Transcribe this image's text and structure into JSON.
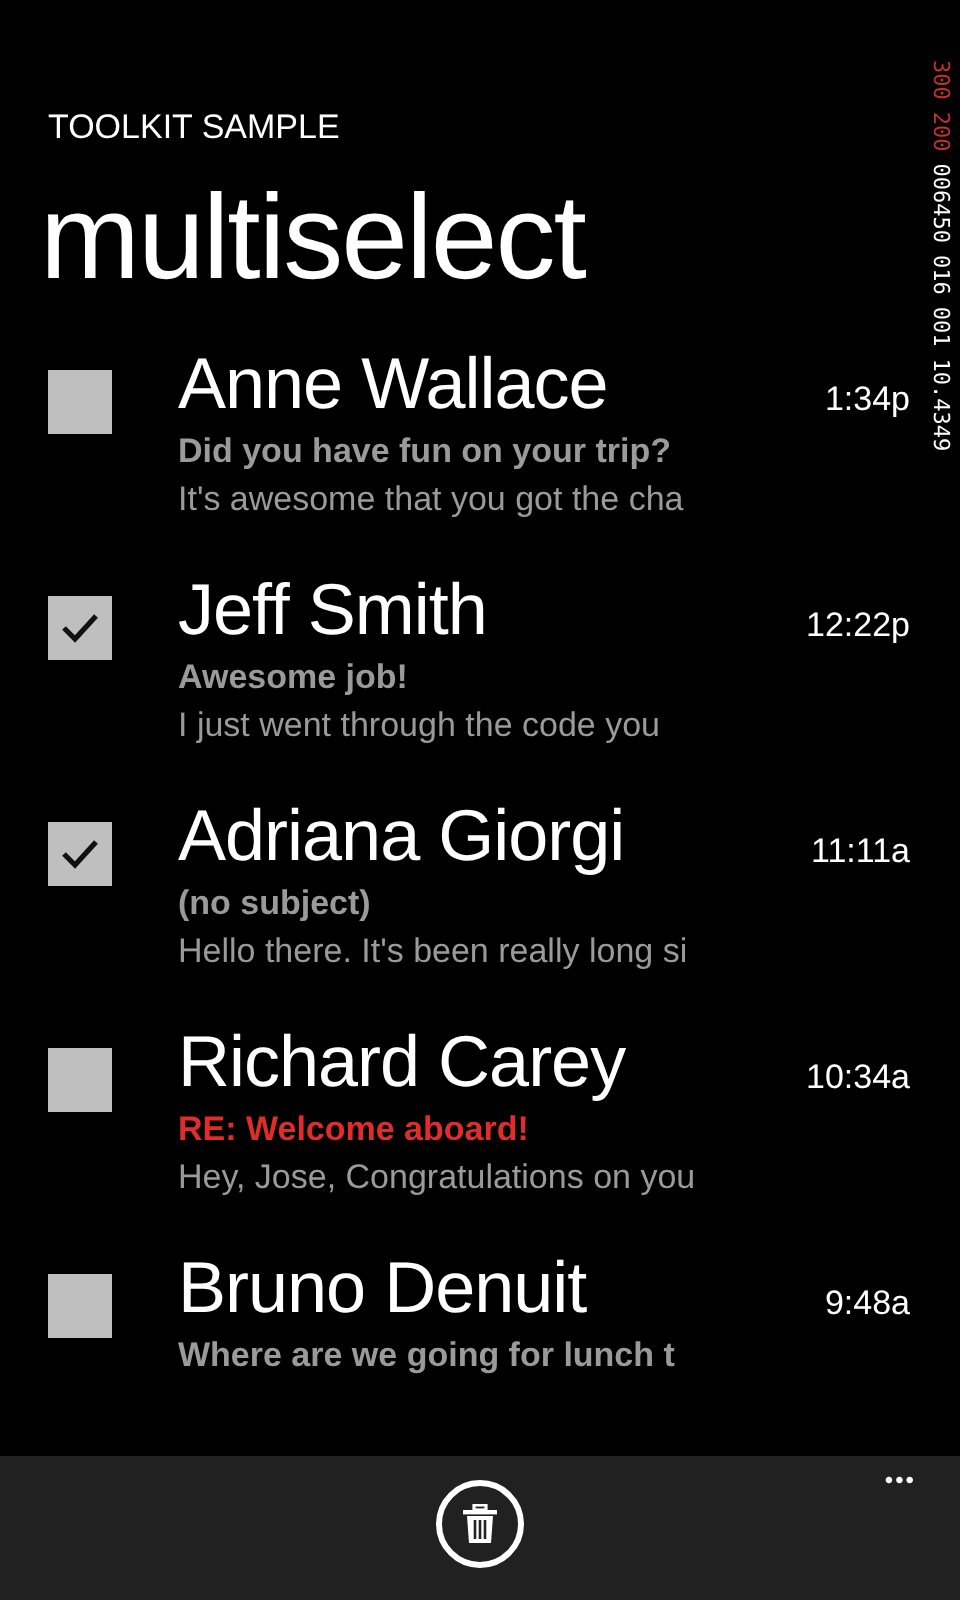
{
  "app_title": "TOOLKIT SAMPLE",
  "page_title": "multiselect",
  "messages": [
    {
      "sender": "Anne Wallace",
      "time": "1:34p",
      "subject": {
        "text": "Did you have fun on your trip?",
        "color": "#9a9a9a"
      },
      "preview": "It's awesome that you got the cha",
      "checked": false
    },
    {
      "sender": "Jeff Smith",
      "time": "12:22p",
      "subject": {
        "text": "Awesome job!",
        "color": "#9a9a9a"
      },
      "preview": "I just went through the code you",
      "checked": true
    },
    {
      "sender": "Adriana Giorgi",
      "time": "11:11a",
      "subject": {
        "text": "(no subject)",
        "color": "#9a9a9a"
      },
      "preview": "Hello there. It's been really long si",
      "checked": true
    },
    {
      "sender": "Richard Carey",
      "time": "10:34a",
      "subject": {
        "text": "RE: Welcome aboard!",
        "color": "#e12c2c"
      },
      "preview": "Hey, Jose, Congratulations on you",
      "checked": false
    },
    {
      "sender": "Bruno Denuit",
      "time": "9:48a",
      "subject": {
        "text": "Where are we going for lunch t",
        "color": "#9a9a9a"
      },
      "checked": false
    }
  ],
  "frame_counter": [
    {
      "text": "300",
      "color": "#c8302a"
    },
    {
      "text": "200",
      "color": "#c8302a"
    },
    {
      "text": "006450",
      "color": "#ffffff"
    },
    {
      "text": "016",
      "color": "#ffffff"
    },
    {
      "text": "001",
      "color": "#ffffff"
    },
    {
      "text": "10.4349",
      "color": "#ffffff"
    }
  ],
  "app_bar": {
    "more": "•••"
  }
}
